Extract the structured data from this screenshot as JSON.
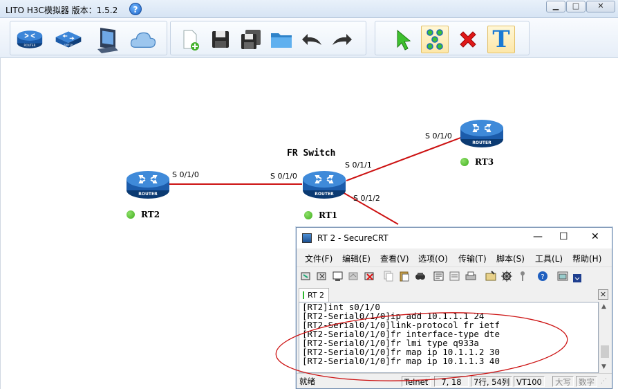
{
  "app": {
    "title": "LITO H3C模拟器 版本：1.5.2",
    "help_glyph": "?",
    "window_buttons": {
      "min": "▁",
      "max": "□",
      "close": "✕"
    }
  },
  "toolbar": {
    "groups": [
      [
        "router-icon",
        "switch-icon",
        "computer-icon",
        "cloud-icon"
      ],
      [
        "new-file-icon",
        "save-icon",
        "save-as-icon",
        "open-folder-icon",
        "undo-icon",
        "redo-icon"
      ],
      [
        "select-pointer-icon",
        "connect-tool-icon",
        "delete-icon",
        "text-tool-icon"
      ]
    ],
    "active": [
      "connect-tool-icon",
      "text-tool-icon"
    ],
    "router_badge": "ROUTER",
    "switch_badge": "SWITCH",
    "text_tool_glyph": "T"
  },
  "topology": {
    "fr_switch_label": "FR Switch",
    "devices": [
      {
        "id": "rt2",
        "label": "RT2",
        "badge": "ROUTER",
        "status_color": "#3fae1c"
      },
      {
        "id": "rt1",
        "label": "RT1",
        "badge": "ROUTER",
        "status_color": "#3fae1c"
      },
      {
        "id": "rt3",
        "label": "RT3",
        "badge": "ROUTER",
        "status_color": "#3fae1c"
      }
    ],
    "ports": {
      "rt2_s010": "S 0/1/0",
      "rt1_s010": "S 0/1/0",
      "rt1_s011": "S 0/1/1",
      "rt1_s012": "S 0/1/2",
      "rt3_s010": "S 0/1/0"
    },
    "link_color": "#cc1111"
  },
  "securecrt": {
    "title": "RT 2 - SecureCRT",
    "window_buttons": {
      "min": "—",
      "max": "☐",
      "close": "✕"
    },
    "menu": [
      "文件(F)",
      "编辑(E)",
      "查看(V)",
      "选项(O)",
      "传输(T)",
      "脚本(S)",
      "工具(L)",
      "帮助(H)"
    ],
    "tab_label": "RT 2",
    "tab_close": "✕",
    "terminal_lines": [
      "[RT2]int s0/1/0",
      "[RT2-Serial0/1/0]ip add 10.1.1.1 24",
      "[RT2-Serial0/1/0]link-protocol fr ietf",
      "[RT2-Serial0/1/0]fr interface-type dte",
      "[RT2-Serial0/1/0]fr lmi type q933a",
      "[RT2-Serial0/1/0]fr map ip 10.1.1.2 30",
      "[RT2-Serial0/1/0]fr map ip 10.1.1.3 40"
    ],
    "status": {
      "ready": "就绪",
      "protocol": "Telnet",
      "cursor": "7, 18",
      "size": "7行, 54列",
      "emulation": "VT100",
      "caps": "大写",
      "num": "数字"
    }
  },
  "annotation_color": "#cc1111"
}
